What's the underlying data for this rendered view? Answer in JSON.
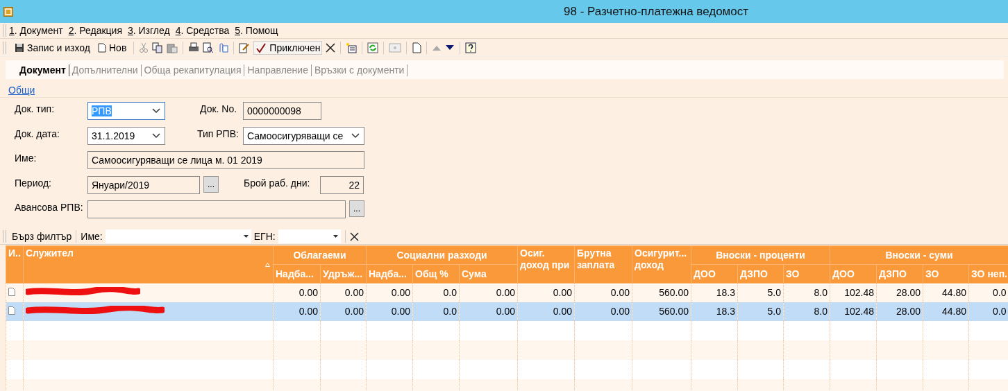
{
  "window": {
    "title": "98 - Разчетно-платежна ведомост"
  },
  "menu": [
    {
      "key": "1",
      "label": ". Документ"
    },
    {
      "key": "2",
      "label": ". Редакция"
    },
    {
      "key": "3",
      "label": ". Изглед"
    },
    {
      "key": "4",
      "label": ". Средства"
    },
    {
      "key": "5",
      "label": ". Помощ"
    }
  ],
  "toolbar": {
    "save": "Запис и изход",
    "new": "Нов",
    "close": {
      "label": "Приключен",
      "pressed": true
    }
  },
  "tabs": [
    {
      "label": "Документ",
      "selected": true
    },
    {
      "label": "Допълнителни",
      "selected": false
    },
    {
      "label": "Обща рекапитулация",
      "selected": false
    },
    {
      "label": "Направление",
      "selected": false
    },
    {
      "label": "Връзки с документи",
      "selected": false
    }
  ],
  "section_link": "Общи",
  "form": {
    "doc_type": {
      "label": "Док. тип:",
      "value": "РПВ"
    },
    "doc_no": {
      "label": "Док. No.",
      "value": "0000000098"
    },
    "doc_date": {
      "label": "Док. дата:",
      "value": "31.1.2019"
    },
    "rpv_type": {
      "label": "Тип РПВ:",
      "value": "Самоосигуряващи се"
    },
    "name": {
      "label": "Име:",
      "value": "Самоосигуряващи се лица м. 01 2019"
    },
    "period": {
      "label": "Период:",
      "value": "Януари/2019",
      "button": "..."
    },
    "work_days": {
      "label": "Брой раб. дни:",
      "value": "22"
    },
    "advance": {
      "label": "Авансова РПВ:",
      "button": "..."
    }
  },
  "filter": {
    "title": "Бърз филтър",
    "name_label": "Име:",
    "egn_label": "ЕГН:"
  },
  "table": {
    "columns": [
      {
        "label": "И.."
      },
      {
        "label": "Служител",
        "sorted": true
      },
      {
        "label": "Облагаеми",
        "children": [
          "Надба...",
          "Удръж..."
        ]
      },
      {
        "label": "Социални разходи",
        "children": [
          "Надба...",
          "Общ %",
          "Сума"
        ]
      },
      {
        "label": "Осиг. доход при"
      },
      {
        "label": "Брутна заплата"
      },
      {
        "label": "Осигурит... доход"
      },
      {
        "label": "Вноски - проценти",
        "children": [
          "ДОО",
          "ДЗПО",
          "ЗО"
        ]
      },
      {
        "label": "Вноски - суми",
        "children": [
          "ДОО",
          "ДЗПО",
          "ЗО",
          "ЗО неп."
        ]
      }
    ],
    "rows": [
      {
        "selected": false,
        "values": [
          "0.00",
          "0.00",
          "0.00",
          "0.0",
          "0.00",
          "0.00",
          "0.00",
          "560.00",
          "18.3",
          "5.0",
          "8.0",
          "102.48",
          "28.00",
          "44.80",
          "0.0"
        ]
      },
      {
        "selected": true,
        "values": [
          "0.00",
          "0.00",
          "0.00",
          "0.0",
          "0.00",
          "0.00",
          "0.00",
          "560.00",
          "18.3",
          "5.0",
          "8.0",
          "102.48",
          "28.00",
          "44.80",
          "0.0"
        ]
      }
    ]
  }
}
